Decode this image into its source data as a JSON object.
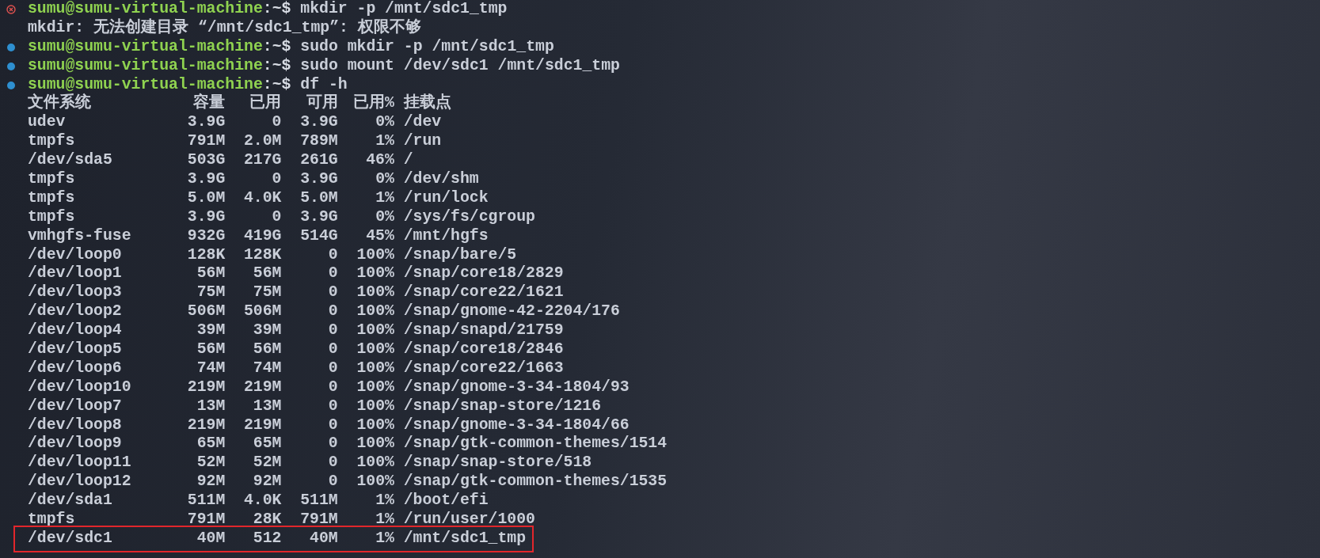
{
  "terminal": {
    "lines": [
      {
        "kind": "command",
        "failed": true,
        "prompt": "sumu@sumu-virtual-machine",
        "cwd": ":~$",
        "command": "mkdir -p /mnt/sdc1_tmp"
      },
      {
        "kind": "output",
        "text": "mkdir: 无法创建目录 “/mnt/sdc1_tmp”: 权限不够"
      },
      {
        "kind": "command",
        "failed": false,
        "prompt": "sumu@sumu-virtual-machine",
        "cwd": ":~$",
        "command": "sudo mkdir -p /mnt/sdc1_tmp"
      },
      {
        "kind": "command",
        "failed": false,
        "prompt": "sumu@sumu-virtual-machine",
        "cwd": ":~$",
        "command": "sudo mount /dev/sdc1 /mnt/sdc1_tmp"
      },
      {
        "kind": "command",
        "failed": false,
        "prompt": "sumu@sumu-virtual-machine",
        "cwd": ":~$",
        "command": "df -h"
      }
    ],
    "df_table": {
      "columns": [
        "文件系统",
        "容量",
        "已用",
        "可用",
        "已用%",
        "挂载点"
      ],
      "rows": [
        {
          "cells": [
            "udev",
            "3.9G",
            "0",
            "3.9G",
            "0%",
            "/dev"
          ],
          "highlighted": false
        },
        {
          "cells": [
            "tmpfs",
            "791M",
            "2.0M",
            "789M",
            "1%",
            "/run"
          ],
          "highlighted": false
        },
        {
          "cells": [
            "/dev/sda5",
            "503G",
            "217G",
            "261G",
            "46%",
            "/"
          ],
          "highlighted": false
        },
        {
          "cells": [
            "tmpfs",
            "3.9G",
            "0",
            "3.9G",
            "0%",
            "/dev/shm"
          ],
          "highlighted": false
        },
        {
          "cells": [
            "tmpfs",
            "5.0M",
            "4.0K",
            "5.0M",
            "1%",
            "/run/lock"
          ],
          "highlighted": false
        },
        {
          "cells": [
            "tmpfs",
            "3.9G",
            "0",
            "3.9G",
            "0%",
            "/sys/fs/cgroup"
          ],
          "highlighted": false
        },
        {
          "cells": [
            "vmhgfs-fuse",
            "932G",
            "419G",
            "514G",
            "45%",
            "/mnt/hgfs"
          ],
          "highlighted": false
        },
        {
          "cells": [
            "/dev/loop0",
            "128K",
            "128K",
            "0",
            "100%",
            "/snap/bare/5"
          ],
          "highlighted": false
        },
        {
          "cells": [
            "/dev/loop1",
            "56M",
            "56M",
            "0",
            "100%",
            "/snap/core18/2829"
          ],
          "highlighted": false
        },
        {
          "cells": [
            "/dev/loop3",
            "75M",
            "75M",
            "0",
            "100%",
            "/snap/core22/1621"
          ],
          "highlighted": false
        },
        {
          "cells": [
            "/dev/loop2",
            "506M",
            "506M",
            "0",
            "100%",
            "/snap/gnome-42-2204/176"
          ],
          "highlighted": false
        },
        {
          "cells": [
            "/dev/loop4",
            "39M",
            "39M",
            "0",
            "100%",
            "/snap/snapd/21759"
          ],
          "highlighted": false
        },
        {
          "cells": [
            "/dev/loop5",
            "56M",
            "56M",
            "0",
            "100%",
            "/snap/core18/2846"
          ],
          "highlighted": false
        },
        {
          "cells": [
            "/dev/loop6",
            "74M",
            "74M",
            "0",
            "100%",
            "/snap/core22/1663"
          ],
          "highlighted": false
        },
        {
          "cells": [
            "/dev/loop10",
            "219M",
            "219M",
            "0",
            "100%",
            "/snap/gnome-3-34-1804/93"
          ],
          "highlighted": false
        },
        {
          "cells": [
            "/dev/loop7",
            "13M",
            "13M",
            "0",
            "100%",
            "/snap/snap-store/1216"
          ],
          "highlighted": false
        },
        {
          "cells": [
            "/dev/loop8",
            "219M",
            "219M",
            "0",
            "100%",
            "/snap/gnome-3-34-1804/66"
          ],
          "highlighted": false
        },
        {
          "cells": [
            "/dev/loop9",
            "65M",
            "65M",
            "0",
            "100%",
            "/snap/gtk-common-themes/1514"
          ],
          "highlighted": false
        },
        {
          "cells": [
            "/dev/loop11",
            "52M",
            "52M",
            "0",
            "100%",
            "/snap/snap-store/518"
          ],
          "highlighted": false
        },
        {
          "cells": [
            "/dev/loop12",
            "92M",
            "92M",
            "0",
            "100%",
            "/snap/gtk-common-themes/1535"
          ],
          "highlighted": false
        },
        {
          "cells": [
            "/dev/sda1",
            "511M",
            "4.0K",
            "511M",
            "1%",
            "/boot/efi"
          ],
          "highlighted": false
        },
        {
          "cells": [
            "tmpfs",
            "791M",
            "28K",
            "791M",
            "1%",
            "/run/user/1000"
          ],
          "highlighted": false
        },
        {
          "cells": [
            "/dev/sdc1",
            "40M",
            "512",
            "40M",
            "1%",
            "/mnt/sdc1_tmp"
          ],
          "highlighted": true
        }
      ]
    }
  }
}
